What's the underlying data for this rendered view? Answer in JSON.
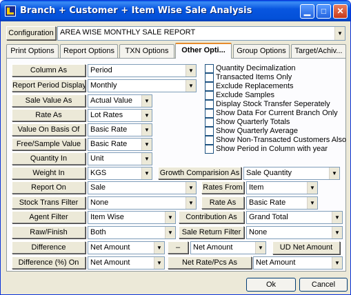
{
  "window": {
    "title": "Branch + Customer + Item Wise Sale Analysis"
  },
  "configuration": {
    "label": "Configuration",
    "value": "AREA WISE MONTHLY SALE REPORT"
  },
  "tabs": [
    {
      "label": "Print Options"
    },
    {
      "label": "Report Options"
    },
    {
      "label": "TXN Options"
    },
    {
      "label": "Other Opti..."
    },
    {
      "label": "Group Options"
    },
    {
      "label": "Target/Achiv..."
    }
  ],
  "fields": {
    "column_as": {
      "label": "Column As",
      "value": "Period"
    },
    "report_period_display": {
      "label": "Report Period Display",
      "value": "Monthly"
    },
    "sale_value_as": {
      "label": "Sale Value As",
      "value": "Actual Value"
    },
    "rate_as": {
      "label": "Rate As",
      "value": "Lot Rates"
    },
    "value_on_basis_of": {
      "label": "Value On Basis Of",
      "value": "Basic Rate"
    },
    "free_sample_value": {
      "label": "Free/Sample Value",
      "value": "Basic Rate"
    },
    "quantity_in": {
      "label": "Quantity In",
      "value": "Unit"
    },
    "weight_in": {
      "label": "Weight In",
      "value": "KGS"
    },
    "growth_comparision_as": {
      "label": "Growth Comparision As",
      "value": "Sale Quantity"
    },
    "report_on": {
      "label": "Report On",
      "value": "Sale"
    },
    "rates_from": {
      "label": "Rates From",
      "value": "Item"
    },
    "stock_trans_filter": {
      "label": "Stock Trans Filter",
      "value": "None"
    },
    "rate_as_2": {
      "label": "Rate As",
      "value": "Basic Rate"
    },
    "agent_filter": {
      "label": "Agent Filter",
      "value": "Item Wise"
    },
    "contribution_as": {
      "label": "Contribution As",
      "value": "Grand Total"
    },
    "raw_finish": {
      "label": "Raw/Finish",
      "value": "Both"
    },
    "sale_return_filter": {
      "label": "Sale Return Filter",
      "value": "None"
    },
    "difference": {
      "label": "Difference",
      "value1": "Net Amount",
      "minus": "–",
      "value2": "Net Amount"
    },
    "ud_net_amount": {
      "label": "UD Net Amount"
    },
    "difference_pct_on": {
      "label": "Difference (%)  On",
      "value": "Net Amount"
    },
    "net_rate_pcs_as": {
      "label": "Net Rate/Pcs As",
      "value": "Net Amount"
    }
  },
  "checkboxes": [
    {
      "label": "Quantity Decimalization",
      "checked": false
    },
    {
      "label": "Transacted Items Only",
      "checked": false
    },
    {
      "label": "Exclude Replacements",
      "checked": false
    },
    {
      "label": "Exclude Samples",
      "checked": false
    },
    {
      "label": "Display Stock Transfer Seperately",
      "checked": false
    },
    {
      "label": "Show Data For Current Branch Only",
      "checked": false
    },
    {
      "label": "Show Quarterly Totals",
      "checked": false
    },
    {
      "label": "Show Quarterly Average",
      "checked": false
    },
    {
      "label": "Show Non-Transacted Customers Also",
      "checked": false
    },
    {
      "label": "Show Period in Column with year",
      "checked": false
    }
  ],
  "buttons": {
    "ok": "Ok",
    "cancel": "Cancel"
  },
  "colors": {
    "titlebar": "#0054e3",
    "face": "#ece9d8",
    "active_tab_accent": "#e68b2c"
  }
}
